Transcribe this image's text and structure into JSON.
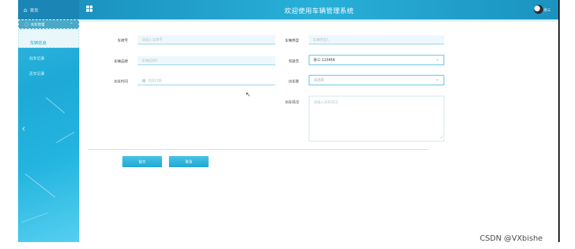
{
  "sidebar": {
    "home_label": "首页",
    "group_label": "出车管理",
    "active_item": "车辆信息",
    "items": [
      {
        "label": "出车记录"
      },
      {
        "label": "还车记录"
      }
    ]
  },
  "header": {
    "title": "欢迎使用车辆管理系统",
    "username": "张三"
  },
  "form": {
    "plate": {
      "label": "车牌号",
      "placeholder": "请输入车牌号"
    },
    "vehicle_type": {
      "label": "车辆类型",
      "placeholder": "车辆类型1"
    },
    "vehicle_brand": {
      "label": "车辆品牌",
      "placeholder": "车辆品牌1"
    },
    "driver": {
      "label": "驾驶员",
      "value": "张三-123456"
    },
    "depart_time": {
      "label": "出车时间",
      "placeholder": "选择日期"
    },
    "depart_count": {
      "label": "出车数",
      "placeholder": "请选择"
    },
    "depart_situation": {
      "label": "出车情况",
      "placeholder": "请输入出车情况"
    },
    "submit_label": "提交",
    "cancel_label": "取消"
  },
  "watermark": "CSDN @VXbishe"
}
